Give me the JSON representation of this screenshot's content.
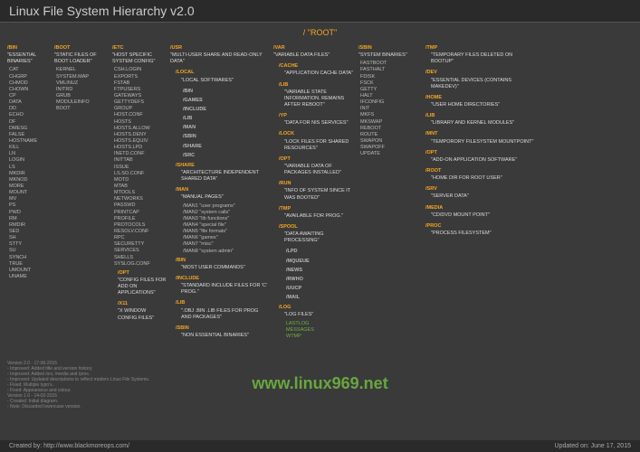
{
  "title": "Linux File System Hierarchy v2.0",
  "root": "/ \"ROOT\"",
  "watermark": "www.linux969.net",
  "footer": {
    "left": "Created by: http://www.blackmoreops.com/",
    "right": "Updated on: June 17, 2015"
  },
  "version": "Version 2.0 - 17-06-2015\n- Improved: Added title and version history.\n- Improved: Added /srv, /media and /proc.\n- Improved: Updated descriptions to reflect modern Linux File Systems.\n- Fixed: Multiple typo's.\n- Fixed: Appearance and colour.\nVersion 1.0 - 14-02-2015\n- Created: Initial diagram.\n- Note: Discarded lowercase version.",
  "bin": {
    "h": "/BIN",
    "d": "\"ESSENTIAL BINARIES\"",
    "items": [
      "CAT",
      "CHGRP",
      "CHMOD",
      "CHOWN",
      "CP",
      "DATA",
      "DD",
      "ECHO",
      "DF",
      "DMESG",
      "FALSE",
      "HOSTNAME",
      "KILL",
      "LN",
      "LOGIN",
      "LS",
      "MKDIR",
      "MKNOD",
      "MORE",
      "MOUNT",
      "MV",
      "PS",
      "PWD",
      "RM",
      "RMDIR",
      "SED",
      "SH",
      "STTY",
      "SU",
      "SYNCH",
      "TRUE",
      "UMOUNT",
      "UNAME"
    ]
  },
  "boot": {
    "h": "/BOOT",
    "d": "\"STATIC FILES OF BOOT LOADER\"",
    "items": [
      "KERNEL",
      "SYSTEM.MAP",
      "VMLINUZ",
      "INITRD",
      "GRUB",
      "MODULEINFO",
      "BOOT"
    ]
  },
  "etc": {
    "h": "/ETC",
    "d": "\"HOST SPECIFIC SYSTEM CONFIG\"",
    "items": [
      "CSH.LOGIN",
      "EXPORTS",
      "FSTAB",
      "FTPUSERS",
      "GATEWAYS",
      "GETTYDEFS",
      "GROUP",
      "HOST.CONF",
      "HOSTS",
      "HOSTS.ALLOW",
      "HOSTS.DENY",
      "HOSTS.EQUIV",
      "HOSTS.LPD",
      "INETD.CONF",
      "INITTAB",
      "ISSUE",
      "LS.SO.CONF",
      "MOTD",
      "MTAB",
      "MTOOLS",
      "NETWORKS",
      "PASSWD",
      "PRINTCAP",
      "PROFILE",
      "PROTOCOLS",
      "RESOLV.CONF",
      "RPC",
      "SECURETTY",
      "SERVICES",
      "SHELLS",
      "SYSLOG.CONF"
    ],
    "opt": {
      "h": "/OPT",
      "d": "\"CONFIG FILES FOR ADD ON APPLICATIONS\""
    },
    "x11": {
      "h": "/X11",
      "d": "\"X WINDOW CONFIG FILES\""
    }
  },
  "usr": {
    "h": "/USR",
    "d": "\"MULTI-USER SHARE AND READ-ONLY DATA\"",
    "local": {
      "h": "/LOCAL",
      "d": "\"LOCAL SOFTWARES\"",
      "items": [
        "/BIN",
        "/GAMES",
        "/INCLUDE",
        "/LIB",
        "/MAN",
        "/SBIN",
        "/SHARE",
        "/SRC"
      ]
    },
    "share": {
      "h": "/SHARE",
      "d": "\"ARCHITECTURE INDEPENDENT SHARED DATA\""
    },
    "man": {
      "h": "/MAN",
      "d": "\"MANUAL PAGES\"",
      "items": [
        "/MAN1 \"user programs\"",
        "/MAN2 \"system calls\"",
        "/MAN3 \"lib functions\"",
        "/MAN4 \"special file\"",
        "/MAN5 \"file formats\"",
        "/MAN6 \"games\"",
        "/MAN7 \"misc\"",
        "/MAN8 \"system admin\""
      ]
    },
    "ubin": {
      "h": "/BIN",
      "d": "\"MOST USER COMMANDS\""
    },
    "inc": {
      "h": "/INCLUDE",
      "d": "\"STANDARD INCLUDE FILES FOR 'C' PROG.\""
    },
    "lib": {
      "h": "/LIB",
      "d": "\".OBJ .BIN .LIB FILES FOR PROG AND PACKAGES\""
    },
    "usbin": {
      "h": "/SBIN",
      "d": "\"NON ESSENTIAL BINARIES\""
    }
  },
  "var": {
    "h": "/VAR",
    "d": "\"VARIABLE DATA FILES\"",
    "cache": {
      "h": "/CACHE",
      "d": "\"APPLICATION CACHE DATA\""
    },
    "lib": {
      "h": "/LIB",
      "d": "\"VARIABLE STATE INFORMATION. REMAINS AFTER REBOOT\""
    },
    "yp": {
      "h": "/YP",
      "d": "\"DATA FOR NIS SERVICES\""
    },
    "lock": {
      "h": "/LOCK",
      "d": "\"LOCK FILES FOR SHARED RESOURCES\""
    },
    "opt": {
      "h": "/OPT",
      "d": "\"VARIABLE DATA OF PACKAGES INSTALLED\""
    },
    "run": {
      "h": "/RUN",
      "d": "\"INFO OF SYSTEM SINCE IT WAS BOOTED\""
    },
    "tmp": {
      "h": "/TMP",
      "d": "\"AVAILABLE FOR PROG.\""
    },
    "spool": {
      "h": "/SPOOL",
      "d": "\"DATA AWAITING PROCESSING\"",
      "items": [
        "/LPD",
        "/MQUEUE",
        "/NEWS",
        "/RWHO",
        "/UUCP",
        "/MAIL"
      ]
    },
    "log": {
      "h": "/LOG",
      "d": "\"LOG FILES\"",
      "items": [
        "LASTLOG",
        "MESSAGES",
        "WTMP"
      ]
    }
  },
  "sbin": {
    "h": "/SBIN",
    "d": "\"SYSTEM BINARIES\"",
    "items": [
      "FASTBOOT",
      "FASTHALT",
      "FDISK",
      "FSCK",
      "GETTY",
      "HALT",
      "IFCONFIG",
      "INIT",
      "MKFS",
      "MKSWAP",
      "REBOOT",
      "ROUTE",
      "SWAPON",
      "SWAPOFF",
      "UPDATE"
    ]
  },
  "right": {
    "tmp": {
      "h": "/TMP",
      "d": "\"TEMPORARY FILES DELETED ON BOOTUP\""
    },
    "dev": {
      "h": "/DEV",
      "d": "\"ESSENTIAL DEVICES (CONTAINS MAKEDEV)\""
    },
    "home": {
      "h": "/HOME",
      "d": "\"USER HOME DIRECTORIES\""
    },
    "lib": {
      "h": "/LIB",
      "d": "\"LIBRARY AND KERNEL MODULES\""
    },
    "mnt": {
      "h": "/MNT",
      "d": "\"TEMPORORY FILESYSTEM MOUNTPOINT\""
    },
    "opt": {
      "h": "/OPT",
      "d": "\"ADD-ON APPLICATION SOFTWARE\""
    },
    "root": {
      "h": "/ROOT",
      "d": "\"HOME DIR FOR ROOT USER\""
    },
    "srv": {
      "h": "/SRV",
      "d": "\"SERVER DATA\""
    },
    "media": {
      "h": "/MEDIA",
      "d": "\"CD/DVD MOUNT POINT\""
    },
    "proc": {
      "h": "/PROC",
      "d": "\"PROCESS FILESYSTEM\""
    }
  }
}
